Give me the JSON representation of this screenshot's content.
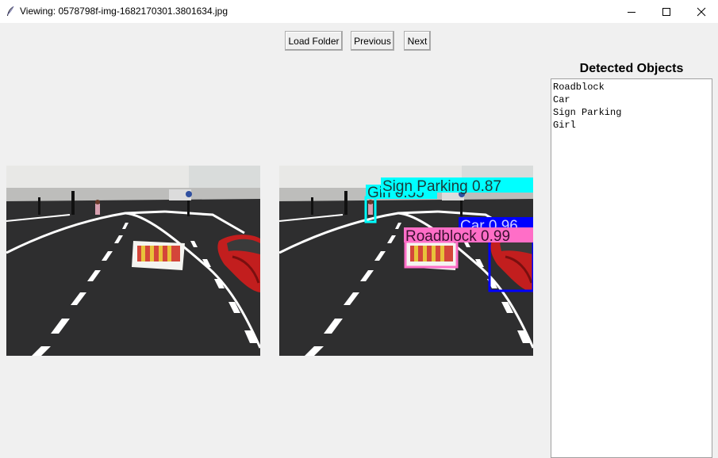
{
  "window": {
    "title": "Viewing: 0578798f-img-1682170301.3801634.jpg",
    "icon": "feather-icon",
    "controls": [
      "minimize-icon",
      "maximize-icon",
      "close-icon"
    ]
  },
  "toolbar": {
    "load_label": "Load Folder",
    "prev_label": "Previous",
    "next_label": "Next"
  },
  "panel": {
    "title": "Detected Objects",
    "items": [
      "Roadblock",
      "Car",
      "Sign Parking",
      "Girl"
    ]
  },
  "detections": [
    {
      "label": "Sign Parking 0.87",
      "color": "#00ffff"
    },
    {
      "label": "Girl 0.55",
      "color": "#00ffff"
    },
    {
      "label": "Car 0.96",
      "color": "#0000ff"
    },
    {
      "label": "Roadblock 0.99",
      "color": "#ff6ec7"
    }
  ]
}
